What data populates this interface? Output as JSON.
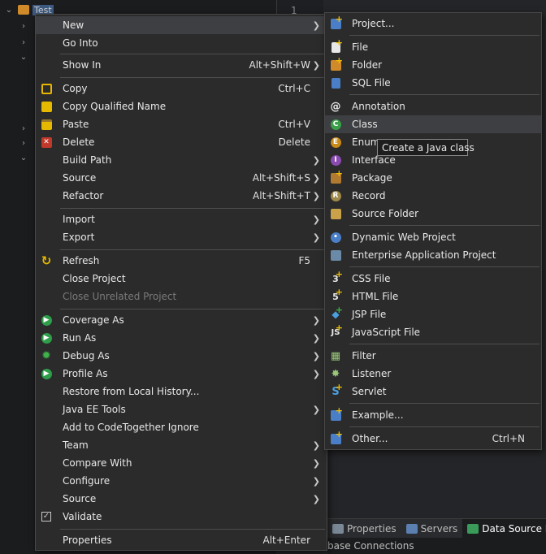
{
  "explorer": {
    "project_label": "Test"
  },
  "editor": {
    "line_number": "1"
  },
  "bottom_panel": {
    "tabs": [
      {
        "label": "Properties",
        "icon": "properties-icon"
      },
      {
        "label": "Servers",
        "icon": "servers-icon"
      },
      {
        "label": "Data Source Expl",
        "icon": "data-source-icon"
      }
    ],
    "content_text": "base Connections"
  },
  "context_menu": {
    "items": [
      {
        "label": "New",
        "shortcut": "",
        "submenu": true,
        "icon": ""
      },
      {
        "label": "Go Into",
        "shortcut": "",
        "submenu": false,
        "icon": ""
      },
      {
        "label": "Show In",
        "shortcut": "Alt+Shift+W",
        "submenu": true,
        "icon": ""
      },
      {
        "label": "Copy",
        "shortcut": "Ctrl+C",
        "submenu": false,
        "icon": "copy-icon"
      },
      {
        "label": "Copy Qualified Name",
        "shortcut": "",
        "submenu": false,
        "icon": "copy-qualified-icon"
      },
      {
        "label": "Paste",
        "shortcut": "Ctrl+V",
        "submenu": false,
        "icon": "paste-icon"
      },
      {
        "label": "Delete",
        "shortcut": "Delete",
        "submenu": false,
        "icon": "delete-icon"
      },
      {
        "label": "Build Path",
        "shortcut": "",
        "submenu": true,
        "icon": ""
      },
      {
        "label": "Source",
        "shortcut": "Alt+Shift+S",
        "submenu": true,
        "icon": ""
      },
      {
        "label": "Refactor",
        "shortcut": "Alt+Shift+T",
        "submenu": true,
        "icon": ""
      },
      {
        "label": "Import",
        "shortcut": "",
        "submenu": true,
        "icon": ""
      },
      {
        "label": "Export",
        "shortcut": "",
        "submenu": true,
        "icon": ""
      },
      {
        "label": "Refresh",
        "shortcut": "F5",
        "submenu": false,
        "icon": "refresh-icon"
      },
      {
        "label": "Close Project",
        "shortcut": "",
        "submenu": false,
        "icon": ""
      },
      {
        "label": "Close Unrelated Project",
        "shortcut": "",
        "submenu": false,
        "icon": "",
        "disabled": true
      },
      {
        "label": "Coverage As",
        "shortcut": "",
        "submenu": true,
        "icon": "coverage-icon"
      },
      {
        "label": "Run As",
        "shortcut": "",
        "submenu": true,
        "icon": "run-icon"
      },
      {
        "label": "Debug As",
        "shortcut": "",
        "submenu": true,
        "icon": "debug-icon"
      },
      {
        "label": "Profile As",
        "shortcut": "",
        "submenu": true,
        "icon": "profile-icon"
      },
      {
        "label": "Restore from Local History...",
        "shortcut": "",
        "submenu": false,
        "icon": ""
      },
      {
        "label": "Java EE Tools",
        "shortcut": "",
        "submenu": true,
        "icon": ""
      },
      {
        "label": "Add to CodeTogether Ignore",
        "shortcut": "",
        "submenu": false,
        "icon": ""
      },
      {
        "label": "Team",
        "shortcut": "",
        "submenu": true,
        "icon": ""
      },
      {
        "label": "Compare With",
        "shortcut": "",
        "submenu": true,
        "icon": ""
      },
      {
        "label": "Configure",
        "shortcut": "",
        "submenu": true,
        "icon": ""
      },
      {
        "label": "Source",
        "shortcut": "",
        "submenu": true,
        "icon": ""
      },
      {
        "label": "Validate",
        "shortcut": "",
        "submenu": false,
        "icon": "validate-icon"
      },
      {
        "label": "Properties",
        "shortcut": "Alt+Enter",
        "submenu": false,
        "icon": ""
      }
    ]
  },
  "new_submenu": {
    "items": [
      {
        "label": "Project...",
        "shortcut": "",
        "icon": "new-project-icon"
      },
      {
        "label": "File",
        "shortcut": "",
        "icon": "new-file-icon"
      },
      {
        "label": "Folder",
        "shortcut": "",
        "icon": "new-folder-icon"
      },
      {
        "label": "SQL File",
        "shortcut": "",
        "icon": "sql-file-icon"
      },
      {
        "label": "Annotation",
        "shortcut": "",
        "icon": "annotation-icon"
      },
      {
        "label": "Class",
        "shortcut": "",
        "icon": "class-icon"
      },
      {
        "label": "Enum",
        "shortcut": "",
        "icon": "enum-icon"
      },
      {
        "label": "Interface",
        "shortcut": "",
        "icon": "interface-icon"
      },
      {
        "label": "Package",
        "shortcut": "",
        "icon": "package-icon"
      },
      {
        "label": "Record",
        "shortcut": "",
        "icon": "record-icon"
      },
      {
        "label": "Source Folder",
        "shortcut": "",
        "icon": "source-folder-icon"
      },
      {
        "label": "Dynamic Web Project",
        "shortcut": "",
        "icon": "dynamic-web-project-icon"
      },
      {
        "label": "Enterprise Application Project",
        "shortcut": "",
        "icon": "enterprise-app-icon"
      },
      {
        "label": "CSS File",
        "shortcut": "",
        "icon": "css-file-icon"
      },
      {
        "label": "HTML File",
        "shortcut": "",
        "icon": "html-file-icon"
      },
      {
        "label": "JSP File",
        "shortcut": "",
        "icon": "jsp-file-icon"
      },
      {
        "label": "JavaScript File",
        "shortcut": "",
        "icon": "javascript-file-icon"
      },
      {
        "label": "Filter",
        "shortcut": "",
        "icon": "filter-icon"
      },
      {
        "label": "Listener",
        "shortcut": "",
        "icon": "listener-icon"
      },
      {
        "label": "Servlet",
        "shortcut": "",
        "icon": "servlet-icon"
      },
      {
        "label": "Example...",
        "shortcut": "",
        "icon": "example-icon"
      },
      {
        "label": "Other...",
        "shortcut": "Ctrl+N",
        "icon": "other-icon"
      }
    ]
  },
  "tooltip": {
    "text": "Create a Java class"
  }
}
